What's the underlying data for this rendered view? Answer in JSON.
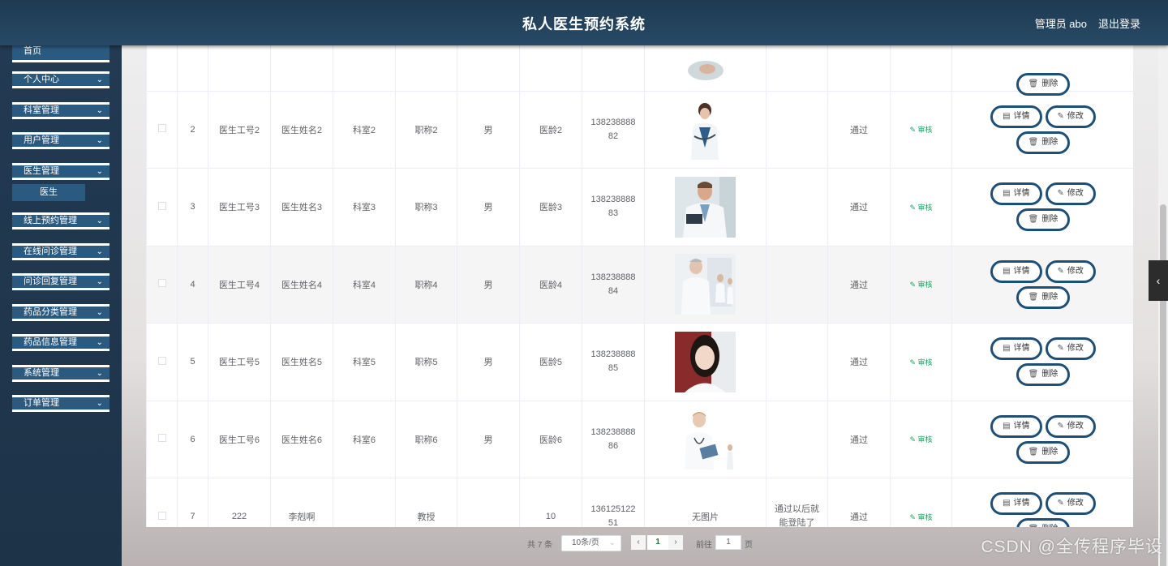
{
  "header": {
    "title": "私人医生预约系统",
    "user": "管理员 abo",
    "logout": "退出登录"
  },
  "sidebar": {
    "items": [
      {
        "label": "首页"
      },
      {
        "label": "个人中心"
      },
      {
        "label": "科室管理"
      },
      {
        "label": "用户管理"
      },
      {
        "label": "医生管理"
      },
      {
        "label": "线上预约管理"
      },
      {
        "label": "在线问诊管理"
      },
      {
        "label": "问诊回复管理"
      },
      {
        "label": "药品分类管理"
      },
      {
        "label": "药品信息管理"
      },
      {
        "label": "系统管理"
      },
      {
        "label": "订单管理"
      }
    ],
    "submenu": "医生",
    "chevron": "⌄"
  },
  "table": {
    "rows": [
      {
        "idx": "2",
        "code": "医生工号2",
        "name": "医生姓名2",
        "dept": "科室2",
        "title": "职称2",
        "sex": "男",
        "age": "医龄2",
        "phone1": "138238888",
        "phone2": "82",
        "img": "doctor-photo",
        "remark": "",
        "status": "通过"
      },
      {
        "idx": "3",
        "code": "医生工号3",
        "name": "医生姓名3",
        "dept": "科室3",
        "title": "职称3",
        "sex": "男",
        "age": "医龄3",
        "phone1": "138238888",
        "phone2": "83",
        "img": "doctor-photo",
        "remark": "",
        "status": "通过"
      },
      {
        "idx": "4",
        "code": "医生工号4",
        "name": "医生姓名4",
        "dept": "科室4",
        "title": "职称4",
        "sex": "男",
        "age": "医龄4",
        "phone1": "138238888",
        "phone2": "84",
        "img": "doctor-photo",
        "remark": "",
        "status": "通过"
      },
      {
        "idx": "5",
        "code": "医生工号5",
        "name": "医生姓名5",
        "dept": "科室5",
        "title": "职称5",
        "sex": "男",
        "age": "医龄5",
        "phone1": "138238888",
        "phone2": "85",
        "img": "doctor-photo",
        "remark": "",
        "status": "通过"
      },
      {
        "idx": "6",
        "code": "医生工号6",
        "name": "医生姓名6",
        "dept": "科室6",
        "title": "职称6",
        "sex": "男",
        "age": "医龄6",
        "phone1": "138238888",
        "phone2": "86",
        "img": "doctor-photo",
        "remark": "",
        "status": "通过"
      },
      {
        "idx": "7",
        "code": "222",
        "name": "李剋啊",
        "dept": "",
        "title": "教授",
        "sex": "",
        "age": "10",
        "phone1": "136125122",
        "phone2": "51",
        "img": "无图片",
        "remark": "通过以后就能登陆了",
        "status": "通过"
      }
    ],
    "audit": "审核",
    "btn_detail": "详情",
    "btn_edit": "修改",
    "btn_delete": "删除",
    "icon_detail": "▤",
    "icon_edit": "✎",
    "icon_delete": "🗑"
  },
  "pager": {
    "total": "共 7 条",
    "size": "10条/页",
    "page": "1",
    "goto": "前往",
    "goto_value": "1",
    "ye": "页",
    "prev": "‹",
    "next": "›",
    "arrow": "⌄"
  },
  "watermark": "CSDN @全传程序毕设",
  "side_tab": "‹"
}
